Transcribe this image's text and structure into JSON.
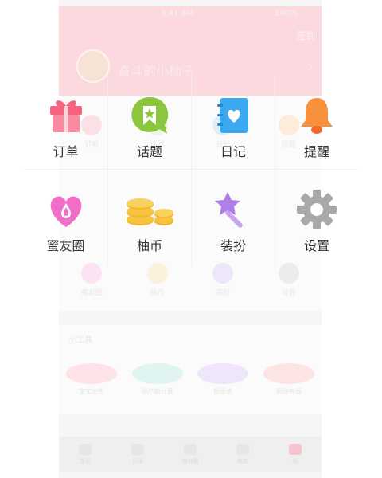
{
  "background_screen": {
    "status_time": "9:41 AM",
    "status_battery": "100%",
    "sign_in_label": "签到",
    "username": "奋斗的小柚子",
    "card_row_1": [
      "订单",
      "话题",
      "日记",
      "提醒"
    ],
    "card_row_2": [
      "蜜友圈",
      "柚币",
      "装扮",
      "设置"
    ],
    "tools_title": "小工具",
    "tools": [
      "宝宝出生",
      "孕产期计算",
      "排便表",
      "调经神器"
    ],
    "tabbar": [
      "首页",
      "记录",
      "柚柚圈",
      "电商",
      "我"
    ]
  },
  "menu": {
    "items": [
      {
        "label": "订单",
        "icon": "gift-icon",
        "color": "#f7637f"
      },
      {
        "label": "话题",
        "icon": "chat-bookmark-icon",
        "color": "#8cc63f"
      },
      {
        "label": "日记",
        "icon": "diary-heart-icon",
        "color": "#3ba8f0"
      },
      {
        "label": "提醒",
        "icon": "bell-icon",
        "color": "#f8903c"
      },
      {
        "label": "蜜友圈",
        "icon": "heart-drop-icon",
        "color": "#f06ec8"
      },
      {
        "label": "柚币",
        "icon": "coins-icon",
        "color": "#f6c343"
      },
      {
        "label": "装扮",
        "icon": "magic-wand-icon",
        "color": "#b07ee8"
      },
      {
        "label": "设置",
        "icon": "gear-icon",
        "color": "#a9a9a9"
      }
    ]
  }
}
